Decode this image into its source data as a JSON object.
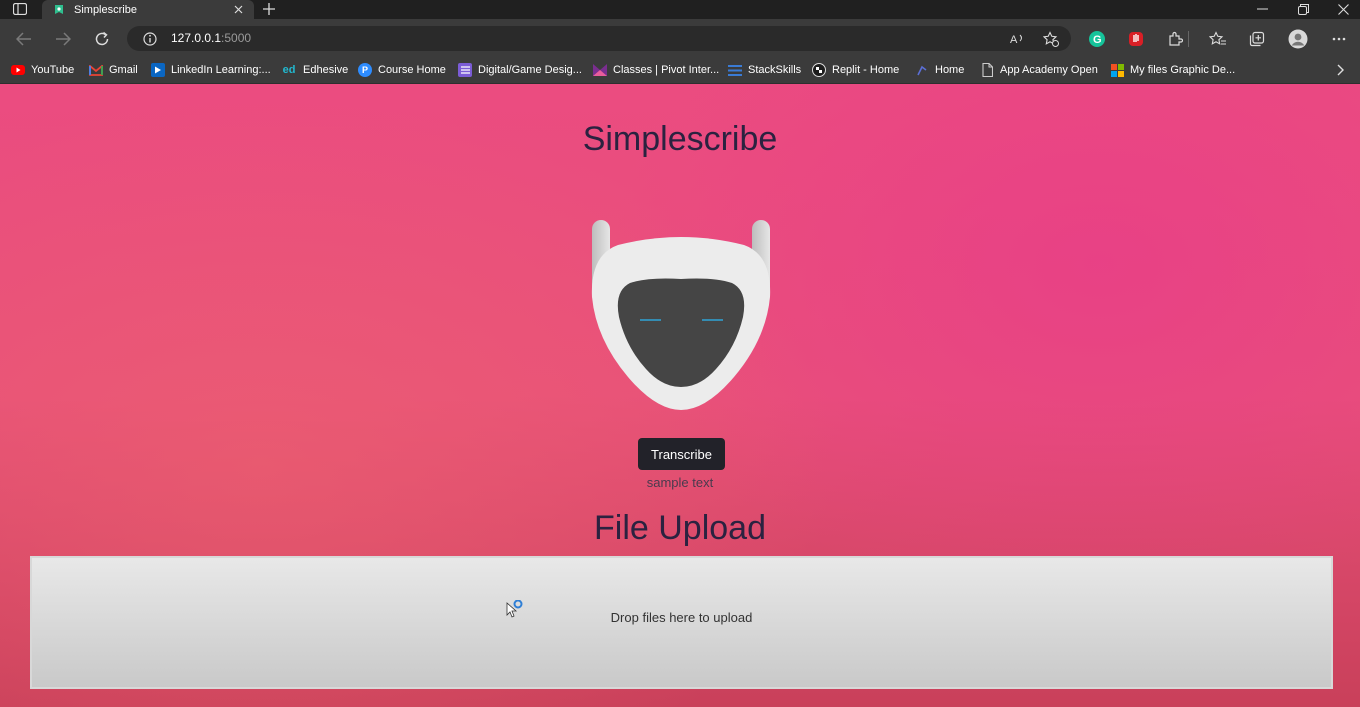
{
  "browser": {
    "tab": {
      "title": "Simplescribe"
    },
    "address": {
      "host": "127.0.0.1",
      "port": ":5000"
    },
    "bookmarks": [
      {
        "label": "YouTube",
        "icon": "youtube-icon",
        "color": "#ff0000"
      },
      {
        "label": "Gmail",
        "icon": "gmail-icon",
        "color": "#ea4335"
      },
      {
        "label": "LinkedIn Learning:...",
        "icon": "linkedin-learning-icon",
        "color": "#0a66c2"
      },
      {
        "label": "Edhesive",
        "icon": "edhesive-icon",
        "color": "#22b8cf"
      },
      {
        "label": "Course Home",
        "icon": "pivot-icon",
        "color": "#2d8cff"
      },
      {
        "label": "Digital/Game Desig...",
        "icon": "list-doc-icon",
        "color": "#7b5cd6"
      },
      {
        "label": "Classes | Pivot Inter...",
        "icon": "pivot-interactives-icon",
        "color": "#7a2e8f"
      },
      {
        "label": "StackSkills",
        "icon": "stackskills-icon",
        "color": "#3a7bd5"
      },
      {
        "label": "Replit - Home",
        "icon": "replit-icon",
        "color": "#f26207"
      },
      {
        "label": "Home",
        "icon": "home-bookmark-icon",
        "color": "#5b6fd6"
      },
      {
        "label": "App Academy Open",
        "icon": "page-icon",
        "color": "#cccccc"
      },
      {
        "label": "My files Graphic De...",
        "icon": "microsoft-icon",
        "color": "#f25022"
      }
    ]
  },
  "page": {
    "title": "Simplescribe",
    "transcribe_label": "Transcribe",
    "sample_text": "sample text",
    "upload_title": "File Upload",
    "dropzone_text": "Drop files here to upload"
  },
  "colors": {
    "page_bg": "#e8457e",
    "heading": "#2b2240",
    "button_bg": "#222229",
    "robot_face": "#ececec",
    "robot_visor": "#454545",
    "robot_eyes": "#2fa4d6"
  }
}
